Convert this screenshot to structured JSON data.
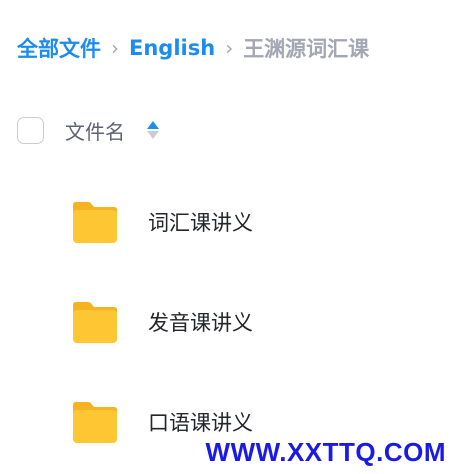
{
  "breadcrumb": {
    "items": [
      {
        "label": "全部文件"
      },
      {
        "label": "English"
      },
      {
        "label": "王渊源词汇课"
      }
    ],
    "separator": "›"
  },
  "list_header": {
    "name_column": "文件名",
    "sort_icon": "sort-toggle-icon"
  },
  "files": [
    {
      "name": "词汇课讲义",
      "type": "folder"
    },
    {
      "name": "发音课讲义",
      "type": "folder"
    },
    {
      "name": "口语课讲义",
      "type": "folder"
    }
  ],
  "watermark": "WWW.XXTTQ.COM",
  "colors": {
    "accent": "#1c8cf0",
    "muted": "#a3a7b3",
    "folder": "#ffc633",
    "watermark": "#1a1ae6"
  }
}
